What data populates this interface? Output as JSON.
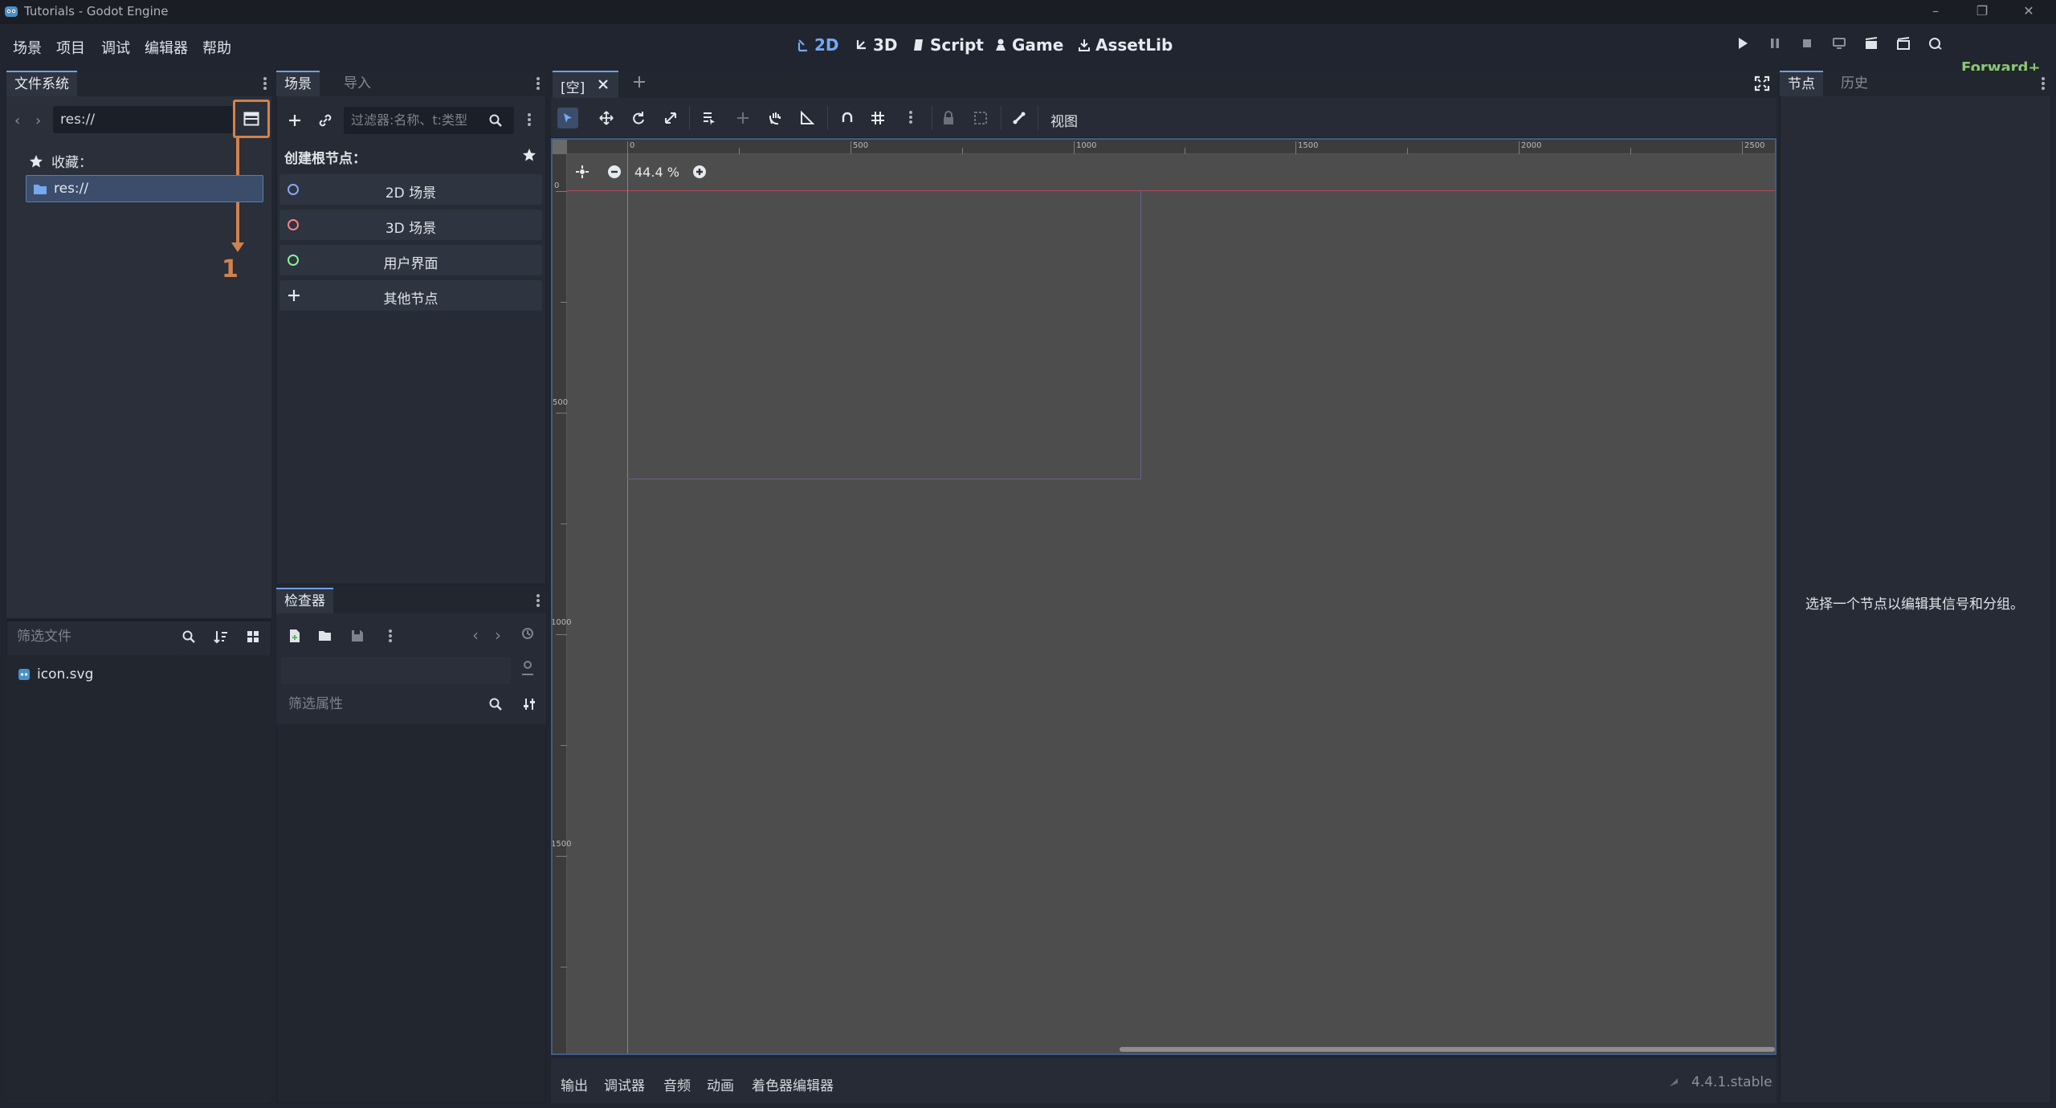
{
  "window": {
    "title": "Tutorials - Godot Engine",
    "controls": [
      "–",
      "❐",
      "✕"
    ]
  },
  "menu": [
    "场景",
    "项目",
    "调试",
    "编辑器",
    "帮助"
  ],
  "workspaces": [
    {
      "label": "2D",
      "icon": "2d-icon",
      "active": true
    },
    {
      "label": "3D",
      "icon": "3d-icon",
      "active": false
    },
    {
      "label": "Script",
      "icon": "script-icon",
      "active": false
    },
    {
      "label": "Game",
      "icon": "game-icon",
      "active": false
    },
    {
      "label": "AssetLib",
      "icon": "assetlib-icon",
      "active": false
    }
  ],
  "renderer": "Forward+",
  "filesystem": {
    "tab": "文件系统",
    "path": "res://",
    "favorites_label": "收藏：",
    "root_item": "res://",
    "filter_placeholder": "筛选文件",
    "files": [
      "icon.svg"
    ]
  },
  "annotation": {
    "number": "1",
    "color": "#d0824e"
  },
  "scene_dock": {
    "tabs": [
      "场景",
      "导入"
    ],
    "filter_placeholder": "过滤器:名称、t:类型",
    "create_root_label": "创建根节点：",
    "root_options": [
      "2D 场景",
      "3D 场景",
      "用户界面",
      "其他节点"
    ],
    "option_colors": [
      "#8da5f3",
      "#fc7f7f",
      "#8eef97",
      "#e0e0e0"
    ]
  },
  "inspector": {
    "tab": "检查器",
    "filter_placeholder": "筛选属性"
  },
  "editor": {
    "tab_label": "[空]",
    "view_menu": "视图",
    "zoom": "44.4 %",
    "ruler_labels_x": [
      "0",
      "500",
      "1000",
      "1500",
      "2000",
      "2500"
    ],
    "ruler_labels_y": [
      "0",
      "500",
      "1000",
      "1500"
    ]
  },
  "bottom_panel": {
    "tabs": [
      "输出",
      "调试器",
      "音频",
      "动画",
      "着色器编辑器"
    ],
    "version": "4.4.1.stable"
  },
  "node_dock": {
    "tabs": [
      "节点",
      "历史"
    ],
    "message": "选择一个节点以编辑其信号和分组。"
  }
}
